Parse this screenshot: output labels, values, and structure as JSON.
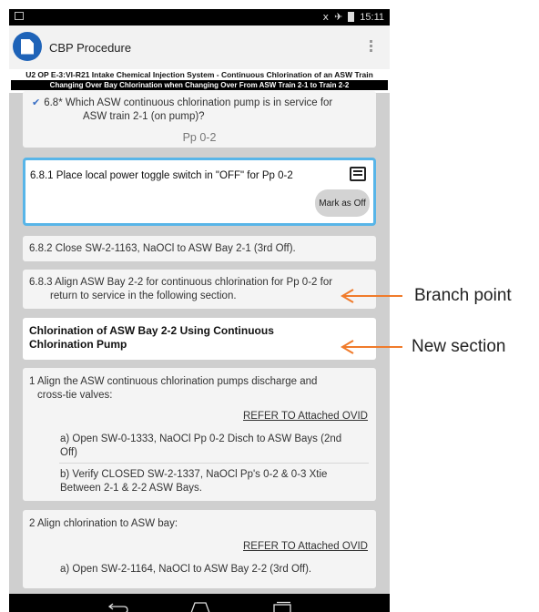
{
  "status": {
    "time": "15:11"
  },
  "app": {
    "title": "CBP Procedure"
  },
  "banner": {
    "line1": "U2 OP E-3:VI-R21 Intake Chemical Injection System - Continuous Chlorination of an ASW Train",
    "line2": "Changing Over Bay Chlorination when Changing Over From ASW Train 2-1 to Train 2-2"
  },
  "steps": {
    "s68_line1": "6.8* Which ASW continuous chlorination pump is in service for",
    "s68_line2": "ASW train 2-1 (on pump)?",
    "s68_answer": "Pp 0-2",
    "s681": "6.8.1 Place local power toggle switch in \"OFF\" for Pp 0-2",
    "s681_button": "Mark as Off",
    "s682": "6.8.2 Close SW-2-1163, NaOCl to ASW Bay 2-1 (3rd Off).",
    "s683_line1": "6.8.3 Align ASW Bay 2-2 for continuous chlorination for Pp 0-2 for",
    "s683_line2": "return to service in the following section."
  },
  "section": {
    "title_line1": "Chlorination of ASW Bay 2-2 Using Continuous",
    "title_line2": "Chlorination Pump"
  },
  "sub": {
    "s1_line1": "1 Align the ASW continuous chlorination pumps discharge and",
    "s1_line2": "cross-tie valves:",
    "s1_ref": "REFER TO Attached OVID",
    "s1a_line1": "a) Open SW-0-1333, NaOCl Pp 0-2 Disch to ASW Bays (2nd",
    "s1a_line2": "Off)",
    "s1b_line1": "b) Verify CLOSED SW-2-1337, NaOCl Pp's 0-2 & 0-3 Xtie",
    "s1b_line2": "Between 2-1 & 2-2 ASW Bays.",
    "s2_line1": "2 Align chlorination to ASW bay:",
    "s2_ref": "REFER TO Attached OVID",
    "s2a": "a) Open SW-2-1164, NaOCl to ASW Bay 2-2 (3rd Off)."
  },
  "annotations": {
    "branch": "Branch point",
    "new_section": "New section"
  },
  "colors": {
    "accent": "#58b5e8",
    "app_icon": "#1e63b8",
    "arrow": "#f07b2b"
  },
  "icons": [
    "wifi-icon",
    "airplane-icon",
    "battery-icon",
    "document-icon",
    "overflow-menu-icon",
    "check-icon",
    "note-icon",
    "back-icon",
    "home-icon",
    "recents-icon"
  ]
}
